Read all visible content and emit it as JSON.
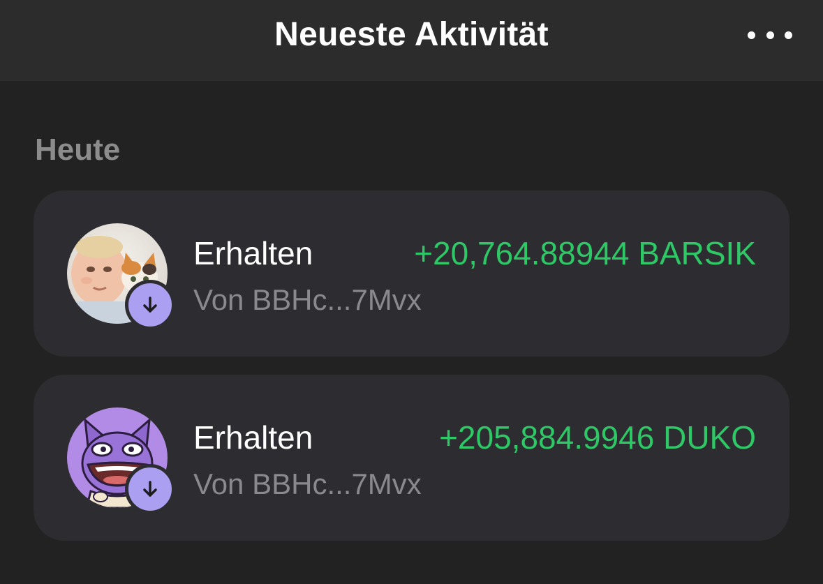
{
  "header": {
    "title": "Neueste Aktivität",
    "more_icon": "ellipsis-icon"
  },
  "section": {
    "label": "Heute"
  },
  "transactions": [
    {
      "type_label": "Erhalten",
      "amount": "+20,764.88944 BARSIK",
      "from": "Von BBHc...7Mvx",
      "avatar_icon": "token-barsik-avatar",
      "badge_icon": "arrow-down-icon"
    },
    {
      "type_label": "Erhalten",
      "amount": "+205,884.9946 DUKO",
      "from": "Von BBHc...7Mvx",
      "avatar_icon": "token-duko-avatar",
      "badge_icon": "arrow-down-icon"
    }
  ],
  "colors": {
    "background": "#222222",
    "header": "#2c2c2c",
    "card": "#2d2d31",
    "positive": "#2ec866",
    "badge": "#ab9ff2",
    "muted": "#8a8a8e"
  }
}
